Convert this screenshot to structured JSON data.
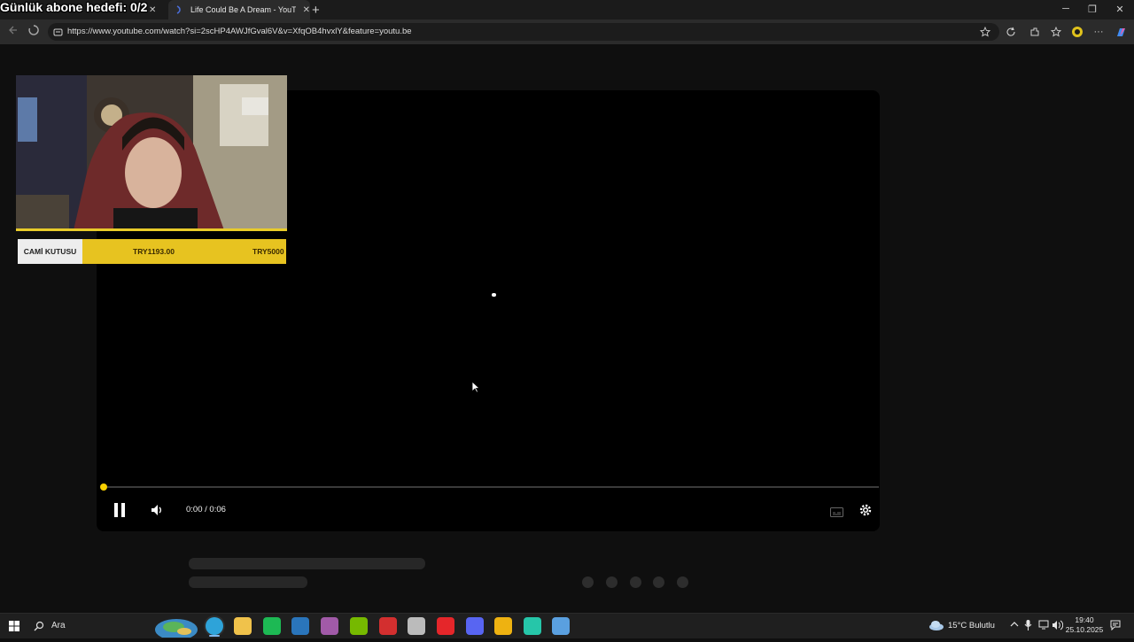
{
  "overlay": {
    "goal_text": "Günlük abone hedefi: 0/2"
  },
  "tabs": [
    {
      "title": "",
      "close": "✕"
    },
    {
      "title": "Life Could Be A Dream - YouTube",
      "close": "✕"
    }
  ],
  "new_tab": "+",
  "window_controls": {
    "minimize": "─",
    "maximize": "❐",
    "close": "✕"
  },
  "address_bar": {
    "url": "https://www.youtube.com/watch?si=2scHP4AWJfGval6V&v=XfqOB4hvxlY&feature=youtu.be"
  },
  "player": {
    "time_current": "0:00",
    "time_separator": "/",
    "time_total": "0:06",
    "progress": 0.0,
    "state": "playing",
    "accent_color": "#f7d000"
  },
  "donation": {
    "label": "CAMİ KUTUSU",
    "current": "TRY1193.00",
    "target": "TRY5000",
    "bar_color": "#e7c320"
  },
  "taskbar": {
    "search_label": "Ara",
    "apps": [
      {
        "icon": "edge-icon",
        "color": "#2ea3d9"
      },
      {
        "icon": "file-explorer-icon",
        "color": "#f0c24b"
      },
      {
        "icon": "spotify-icon",
        "color": "#1db954"
      },
      {
        "icon": "steam-icon",
        "color": "#2a75bb"
      },
      {
        "icon": "visual-studio-icon",
        "color": "#a15aa8"
      },
      {
        "icon": "nvidia-icon",
        "color": "#76b900"
      },
      {
        "icon": "red-app-icon",
        "color": "#d32f2f"
      },
      {
        "icon": "game-app-icon",
        "color": "#bbbbbb"
      },
      {
        "icon": "opera-icon",
        "color": "#e5262a"
      },
      {
        "icon": "discord-icon",
        "color": "#5865f2"
      },
      {
        "icon": "chrome-icon",
        "color": "#eeb211"
      },
      {
        "icon": "teal-app-icon",
        "color": "#26c6a9"
      },
      {
        "icon": "steam-alt-icon",
        "color": "#5aa0e0"
      }
    ],
    "weather": "15°C  Bulutlu",
    "time": "19:40",
    "date": "25.10.2025"
  }
}
